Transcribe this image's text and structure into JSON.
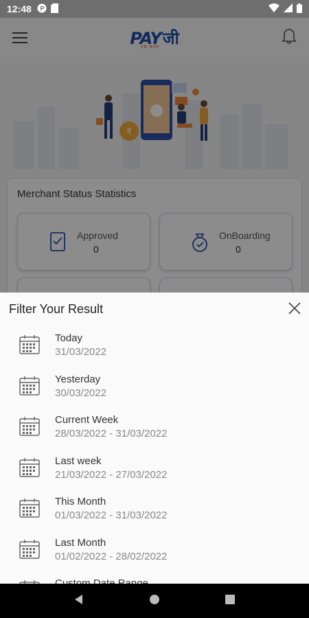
{
  "status_bar": {
    "time": "12:48"
  },
  "header": {
    "logo_main": "PAY",
    "logo_ji": "जी",
    "logo_tagline": "एक कदम"
  },
  "stats": {
    "title": "Merchant Status Statistics",
    "tiles": [
      {
        "label": "Approved",
        "value": "0",
        "icon": "approved-icon"
      },
      {
        "label": "OnBoarding",
        "value": "0",
        "icon": "money-bag-icon"
      }
    ]
  },
  "sheet": {
    "title": "Filter Your Result",
    "items": [
      {
        "label": "Today",
        "date": "31/03/2022"
      },
      {
        "label": "Yesterday",
        "date": "30/03/2022"
      },
      {
        "label": "Current Week",
        "date": "28/03/2022 - 31/03/2022"
      },
      {
        "label": "Last week",
        "date": "21/03/2022 - 27/03/2022"
      },
      {
        "label": "This Month",
        "date": "01/03/2022 - 31/03/2022"
      },
      {
        "label": "Last Month",
        "date": "01/02/2022 - 28/02/2022"
      },
      {
        "label": "Custom Date Range",
        "date": ""
      }
    ]
  }
}
